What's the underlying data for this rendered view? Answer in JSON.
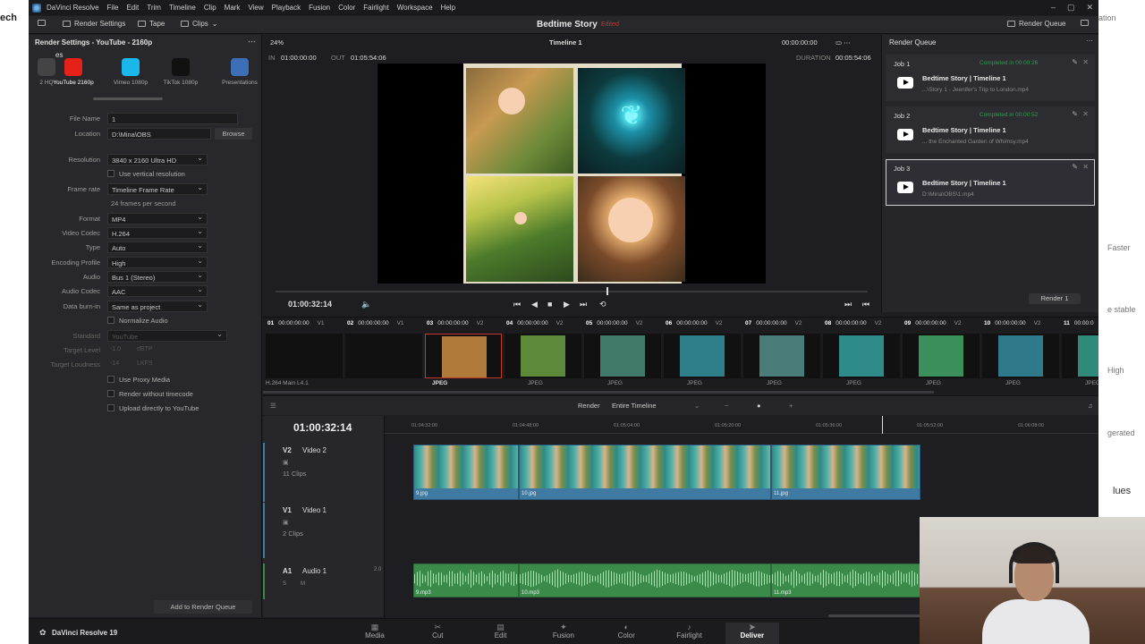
{
  "page_left_text": "ech",
  "menu": [
    "DaVinci Resolve",
    "File",
    "Edit",
    "Trim",
    "Timeline",
    "Clip",
    "Mark",
    "View",
    "Playback",
    "Fusion",
    "Color",
    "Fairlight",
    "Workspace",
    "Help"
  ],
  "toolbar": {
    "render_settings": "Render Settings",
    "tape": "Tape",
    "clips": "Clips",
    "project": "Bedtime Story",
    "edited": "Edited",
    "render_queue": "Render Queue"
  },
  "render_settings": {
    "title": "Render Settings - YouTube - 2160p",
    "presets": [
      {
        "label": "es",
        "sub": "2 HQ",
        "color": "#444"
      },
      {
        "label": "YouTube 2160p",
        "color": "#e62117"
      },
      {
        "label": "Vimeo 1080p",
        "color": "#1ab7ea"
      },
      {
        "label": "TikTok 1080p",
        "color": "#111111"
      },
      {
        "label": "Presentations",
        "color": "#3c6fb6"
      }
    ],
    "file_name_label": "File Name",
    "file_name": "1",
    "location_label": "Location",
    "location": "D:\\Mina\\OBS",
    "browse": "Browse",
    "resolution_label": "Resolution",
    "resolution": "3840 x 2160 Ultra HD",
    "vertical_res": "Use vertical resolution",
    "frame_rate_label": "Frame rate",
    "frame_rate": "Timeline Frame Rate",
    "fps_note": "24 frames per second",
    "format_label": "Format",
    "format": "MP4",
    "video_codec_label": "Video Codec",
    "video_codec": "H.264",
    "type_label": "Type",
    "type": "Auto",
    "encoding_profile_label": "Encoding Profile",
    "encoding_profile": "High",
    "audio_label": "Audio",
    "audio": "Bus 1 (Stereo)",
    "audio_codec_label": "Audio Codec",
    "audio_codec": "AAC",
    "data_burnin_label": "Data burn-in",
    "data_burnin": "Same as project",
    "normalize_audio": "Normalize Audio",
    "standard_label": "Standard",
    "standard": "YouTube",
    "target_level_label": "Target Level",
    "target_level": "-1.0",
    "target_level_unit": "dBTP",
    "target_loudness_label": "Target Loudness",
    "target_loudness": "-14",
    "target_loudness_unit": "LKFS",
    "use_proxy": "Use Proxy Media",
    "render_without_tc": "Render without timecode",
    "upload_youtube": "Upload directly to YouTube",
    "add_to_queue": "Add to Render Queue"
  },
  "viewer": {
    "zoom": "24%",
    "timeline_name": "Timeline 1",
    "tc_top": "00:00:00:00",
    "in_label": "IN",
    "in_tc": "01:00:00:00",
    "out_label": "OUT",
    "out_tc": "01:05:54:06",
    "duration_label": "DURATION",
    "duration": "00:05:54:06",
    "current_tc": "01:00:32:14"
  },
  "queue": {
    "title": "Render Queue",
    "jobs": [
      {
        "name": "Job 1",
        "status": "Completed in 00:00:26",
        "title": "Bedtime Story | Timeline 1",
        "path": "...\\Story 1 - Jeenifer's Trip to London.mp4"
      },
      {
        "name": "Job 2",
        "status": "Completed in 00:00:52",
        "title": "Bedtime Story | Timeline 1",
        "path": "... the Enchanted Garden of Whimsy.mp4"
      },
      {
        "name": "Job 3",
        "status": "",
        "title": "Bedtime Story | Timeline 1",
        "path": "D:\\Mina\\OBS\\1.mp4"
      }
    ],
    "render_button": "Render 1"
  },
  "clips": [
    {
      "num": "01",
      "tc": "00:00:00:00",
      "track": "V1",
      "fmt": "H.264 Main L4.1",
      "color": "#111"
    },
    {
      "num": "02",
      "tc": "00:00:00:00",
      "track": "V1",
      "fmt": "",
      "color": "#000"
    },
    {
      "num": "03",
      "tc": "00:00:00:00",
      "track": "V2",
      "fmt": "JPEG",
      "color": "#b07a3a"
    },
    {
      "num": "04",
      "tc": "00:00:00:00",
      "track": "V2",
      "fmt": "JPEG",
      "color": "#5d8a3a"
    },
    {
      "num": "05",
      "tc": "00:00:00:00",
      "track": "V2",
      "fmt": "JPEG",
      "color": "#3f7a6a"
    },
    {
      "num": "06",
      "tc": "00:00:00:00",
      "track": "V2",
      "fmt": "JPEG",
      "color": "#2f7f8a"
    },
    {
      "num": "07",
      "tc": "00:00:00:00",
      "track": "V2",
      "fmt": "JPEG",
      "color": "#4a7d7a"
    },
    {
      "num": "08",
      "tc": "00:00:00:00",
      "track": "V2",
      "fmt": "JPEG",
      "color": "#2f8a8a"
    },
    {
      "num": "09",
      "tc": "00:00:00:00",
      "track": "V2",
      "fmt": "JPEG",
      "color": "#3a8f5a"
    },
    {
      "num": "10",
      "tc": "00:00:00:00",
      "track": "V2",
      "fmt": "JPEG",
      "color": "#2f7a8a"
    },
    {
      "num": "11",
      "tc": "00:00:0",
      "track": "",
      "fmt": "JPEG",
      "color": "#2f8a7a"
    }
  ],
  "renderbar": {
    "render_label": "Render",
    "render_mode": "Entire Timeline"
  },
  "timeline": {
    "tc": "01:00:32:14",
    "ruler": [
      "01:04:32:00",
      "01:04:48:00",
      "01:05:04:00",
      "01:05:20:00",
      "01:05:36:00",
      "01:05:52:00",
      "01:06:08:00"
    ],
    "v2": {
      "id": "V2",
      "name": "Video 2",
      "count": "11 Clips"
    },
    "v1": {
      "id": "V1",
      "name": "Video 1",
      "count": "2 Clips"
    },
    "a1": {
      "id": "A1",
      "name": "Audio 1",
      "level": "2.0"
    },
    "video_clips": [
      "9.jpg",
      "10.jpg",
      "11.jpg"
    ],
    "audio_clips": [
      "9.mp3",
      "10.mp3",
      "11.mp3"
    ]
  },
  "pages": [
    "Media",
    "Cut",
    "Edit",
    "Fusion",
    "Color",
    "Fairlight",
    "Deliver"
  ],
  "brand": "DaVinci Resolve 19",
  "right_bg": [
    "ation",
    "Faster",
    "e stable",
    "High",
    "gerated",
    "lues"
  ]
}
